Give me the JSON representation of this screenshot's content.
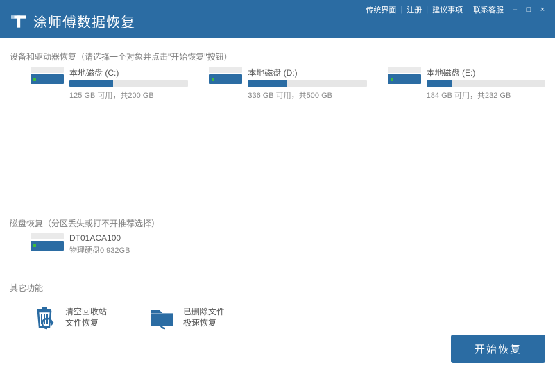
{
  "header": {
    "title": "涂师傅数据恢复",
    "links": [
      "传统界面",
      "注册",
      "建议事项",
      "联系客服"
    ]
  },
  "section_drives": {
    "label": "设备和驱动器恢复（请选择一个对象并点击\"开始恢复\"按钮）",
    "items": [
      {
        "name": "本地磁盘  (C:)",
        "space": "125 GB 可用，共200 GB",
        "pct": 37
      },
      {
        "name": "本地磁盘  (D:)",
        "space": "336 GB 可用，共500 GB",
        "pct": 33
      },
      {
        "name": "本地磁盘  (E:)",
        "space": "184 GB 可用，共232 GB",
        "pct": 21
      }
    ]
  },
  "section_disk": {
    "label": "磁盘恢复（分区丢失或打不开推荐选择）",
    "items": [
      {
        "name": "DT01ACA100",
        "space": "物理硬盘0 932GB"
      }
    ]
  },
  "section_other": {
    "label": "其它功能",
    "items": [
      {
        "line1": "清空回收站",
        "line2": "文件恢复"
      },
      {
        "line1": "已删除文件",
        "line2": "极速恢复"
      }
    ]
  },
  "footer": {
    "start": "开始恢复"
  }
}
